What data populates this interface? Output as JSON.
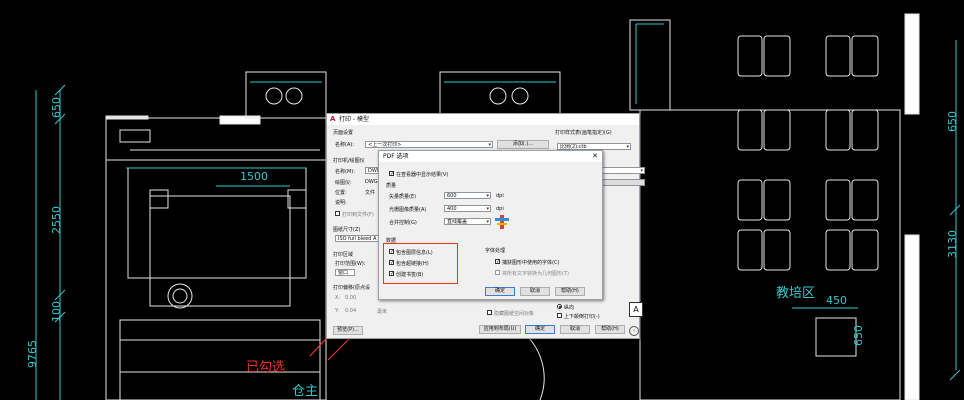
{
  "cad": {
    "dimensions": {
      "d650": "650",
      "d2550": "2550",
      "d100": "100",
      "d9765": "9765",
      "d1500": "1500",
      "d450": "450",
      "d650b": "650",
      "d3130": "3130",
      "d650c": "650"
    },
    "room_label": "教培区",
    "room_label_2": "仓主",
    "annotation": "已勾选"
  },
  "plot_dialog": {
    "title": "打印 - 模型",
    "page_setup_header": "页面设置",
    "name_label": "名称(A):",
    "name_value": "<上一次打印>",
    "add_button": "添加(.)...",
    "printer_header": "打印机/绘图仪",
    "printer_name_label": "名称(M):",
    "printer_value": "DWG To PDF.pc3",
    "plotter_label": "绘图仪:",
    "plotter_value": "DWG T",
    "location_label": "位置:",
    "location_value": "文件",
    "description_label": "说明:",
    "plot_to_file": "打印到文件(F)",
    "paper_size_header": "图纸尺寸(Z)",
    "paper_size_value": "ISO full bleed A",
    "plot_area_header": "打印区域",
    "plot_range_label": "打印范围(W):",
    "plot_range_value": "窗口",
    "plot_offset_header": "打印偏移(原点设",
    "offset_x": "0.00",
    "offset_y": "0.04",
    "offset_unit": "毫米",
    "preview_button": "预览(P)...",
    "style_table_header": "打印样式表(画笔指定)(G)",
    "style_table_value": "比例(2).ctb",
    "orientation_portrait": "纵向",
    "orientation_upside": "上下颠倒打印(-)",
    "hide_paper_space": "隐藏图纸空间对象",
    "apply_layout": "应用到布局(U)",
    "ok": "确定",
    "cancel": "取消",
    "help": "帮助(H)"
  },
  "pdf_dialog": {
    "title": "PDF 选项",
    "view_in_viewer": "在查看器中显示结果(V)",
    "quality_header": "质量",
    "vector_quality_label": "矢量质量(E)",
    "vector_quality_value": "600",
    "raster_quality_label": "光栅图像质量(A)",
    "raster_quality_value": "400",
    "dpi": "dpi",
    "merge_control_label": "合并控制(G)",
    "merge_control_value": "直线覆盖",
    "data_header": "数据",
    "include_layer_info": "包含图层信息(L)",
    "include_hyperlinks": "包含超链接(H)",
    "create_bookmarks": "创建书签(B)",
    "font_header": "字体处理",
    "capture_fonts": "捕获图形中使用的字体(C)",
    "convert_text": "将所有文字转换为几何图形(T)",
    "ok": "确定",
    "cancel": "取消",
    "help": "帮助(H)"
  },
  "colors": {
    "cad_lines": "#e6e6e6",
    "cad_cyan": "#35c7cf",
    "highlight": "#e8342a",
    "accent": "#3a7bd5"
  }
}
